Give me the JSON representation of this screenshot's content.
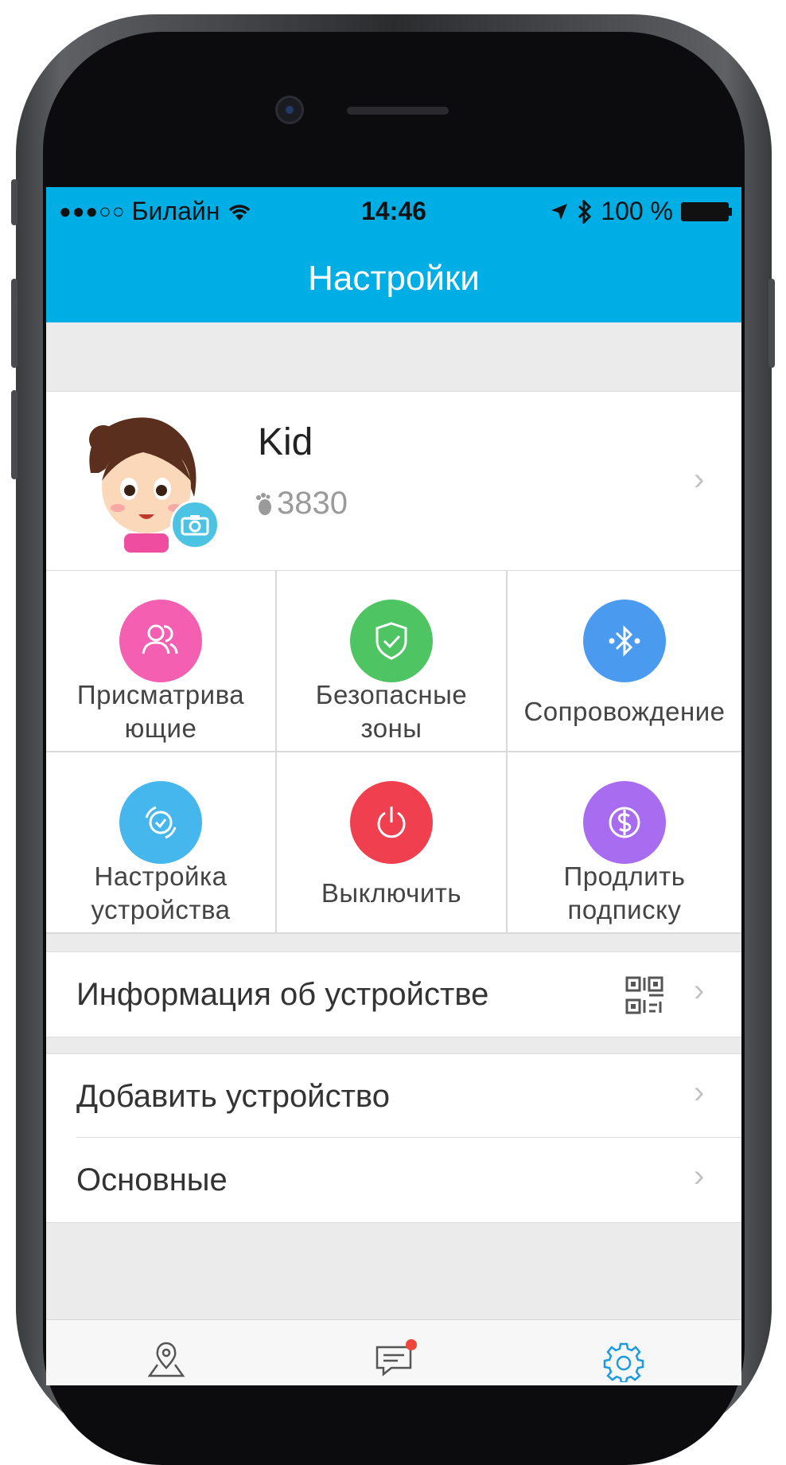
{
  "statusbar": {
    "carrier": "Билайн",
    "time": "14:46",
    "battery": "100 %"
  },
  "header": {
    "title": "Настройки"
  },
  "profile": {
    "name": "Kid",
    "steps": "3830"
  },
  "grid": [
    {
      "label": "Присматрива\nющие",
      "color": "#f45fb1",
      "icon": "guardians-icon"
    },
    {
      "label": "Безопасные\nзоны",
      "color": "#4fc463",
      "icon": "shield-check-icon"
    },
    {
      "label": "Сопровождение",
      "color": "#4a9bf0",
      "icon": "bluetooth-icon"
    },
    {
      "label": "Настройка\nустройства",
      "color": "#46b7ec",
      "icon": "watch-settings-icon"
    },
    {
      "label": "Выключить",
      "color": "#f0404f",
      "icon": "power-icon"
    },
    {
      "label": "Продлить\nподписку",
      "color": "#a76cf0",
      "icon": "dollar-icon"
    }
  ],
  "rows": {
    "device_info": "Информация об устройстве",
    "add_device": "Добавить устройство",
    "general": "Основные"
  },
  "tabbar": {
    "icons": [
      "map-pin-icon",
      "chat-icon",
      "settings-gear-icon"
    ],
    "accent": "#1a9be0"
  }
}
